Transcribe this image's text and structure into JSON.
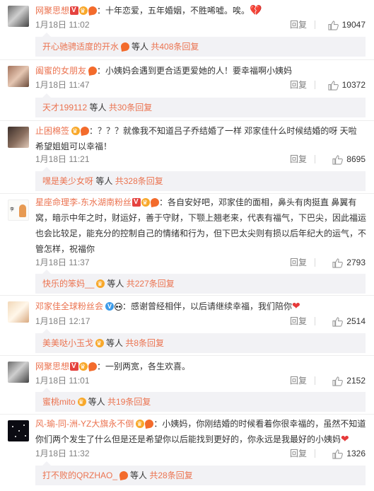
{
  "comments": [
    {
      "username": "网聚思想",
      "text": "：十年恋爱，五年婚姻，不胜唏嘘。唉。",
      "time": "1月18日 11:02",
      "reply_label": "回复",
      "likes": "19047",
      "sub": {
        "name": "开心驰骋适度的开水",
        "mid": "等人",
        "count": "共408条回复"
      }
    },
    {
      "username": "阖蜜的女朋友",
      "text": "：小姨妈会遇到更合适更爱她的人！要幸福啊小姨妈",
      "time": "1月18日 11:47",
      "reply_label": "回复",
      "likes": "10372",
      "sub": {
        "name": "天才199112",
        "mid": "等人",
        "count": "共30条回复"
      }
    },
    {
      "username": "止困棉签",
      "text": "：？？？就像我不知道吕子乔结婚了一样 邓家佳什么时候结婚的呀 天啦 希望姐姐可以幸福！",
      "time": "1月18日 11:21",
      "reply_label": "回复",
      "likes": "8695",
      "sub": {
        "name": "嘿是美少女呀",
        "mid": "等人",
        "count": "共328条回复"
      }
    },
    {
      "username": "星座命理李-东水湖南粉丝",
      "text": "：各自安好吧，邓家佳的面相，鼻头有肉挺直 鼻翼有窝，暗示中年之时，财运好，善于守财，下颚上翘老来，代表有福气，下巴尖，因此福运也会比较足，能充分的控制自己的情绪和行为，但下巴太尖则有损以后年纪大的运气，不管怎样，祝福你",
      "time": "1月18日 11:37",
      "reply_label": "回复",
      "likes": "2793",
      "sub": {
        "name": "快乐的笨妈__",
        "mid": "等人",
        "count": "共227条回复"
      }
    },
    {
      "username": "邓家佳全球粉丝会",
      "text": "：感谢曾经相伴，以后请继续幸福，我们陪你",
      "time": "1月18日 12:17",
      "reply_label": "回复",
      "likes": "2514",
      "sub": {
        "name": "美美哒小玉戈",
        "mid": "等人",
        "count": "共8条回复"
      }
    },
    {
      "username": "网聚思想",
      "text": "：一别两宽，各生欢喜。",
      "time": "1月18日 11:01",
      "reply_label": "回复",
      "likes": "2152",
      "sub": {
        "name": "蜜桃mito",
        "mid": "等人",
        "count": "共19条回复"
      }
    },
    {
      "username": "风-瑜-同-洲-YZ大旗永不倒",
      "text": "：小姨妈，你刚结婚的时候看着你很幸福的，虽然不知道你们两个发生了什么但是还是希望你以后能找到更好的，你永远是我最好的小姨妈",
      "time": "1月18日 11:32",
      "reply_label": "回复",
      "likes": "1326",
      "sub": {
        "name": "打不败的QRZHAO_",
        "mid": "等人",
        "count": "共28条回复"
      }
    }
  ]
}
